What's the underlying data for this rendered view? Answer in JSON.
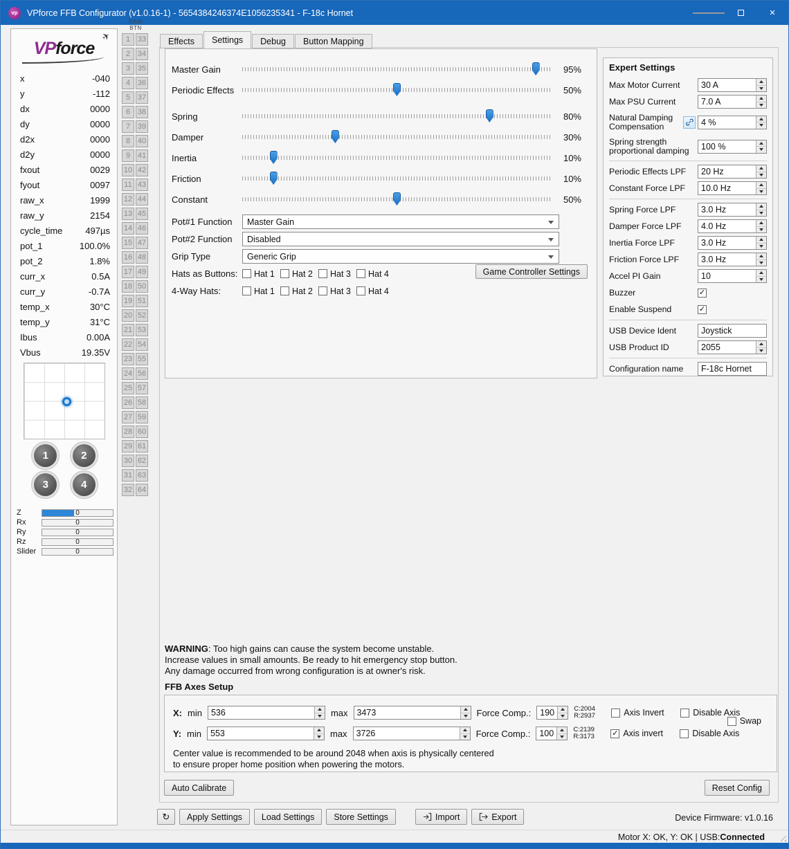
{
  "window": {
    "title": "VPforce FFB Configurator (v1.0.16-1) - 5654384246374E1056235341 - F-18c Hornet",
    "icon_text": "vp",
    "close_glyph": "×"
  },
  "logo": {
    "vp": "VP",
    "force": "force",
    "plane_glyph": "✈"
  },
  "telemetry": [
    {
      "label": "x",
      "value": "-040"
    },
    {
      "label": "y",
      "value": "-112"
    },
    {
      "label": "dx",
      "value": "0000"
    },
    {
      "label": "dy",
      "value": "0000"
    },
    {
      "label": "d2x",
      "value": "0000"
    },
    {
      "label": "d2y",
      "value": "0000"
    },
    {
      "label": "fxout",
      "value": "0029"
    },
    {
      "label": "fyout",
      "value": "0097"
    },
    {
      "label": "raw_x",
      "value": "1999"
    },
    {
      "label": "raw_y",
      "value": "2154"
    },
    {
      "label": "cycle_time",
      "value": "497µs"
    },
    {
      "label": "pot_1",
      "value": "100.0%"
    },
    {
      "label": "pot_2",
      "value": "1.8%"
    },
    {
      "label": "curr_x",
      "value": "0.5A"
    },
    {
      "label": "curr_y",
      "value": "-0.7A"
    },
    {
      "label": "temp_x",
      "value": "30°C"
    },
    {
      "label": "temp_y",
      "value": "31°C"
    },
    {
      "label": "Ibus",
      "value": "0.00A"
    },
    {
      "label": "Vbus",
      "value": "19.35V"
    }
  ],
  "joy_buttons": [
    "1",
    "2",
    "3",
    "4"
  ],
  "axis_bars": [
    {
      "label": "Z",
      "value": "0",
      "fill": 45
    },
    {
      "label": "Rx",
      "value": "0",
      "fill": 0
    },
    {
      "label": "Ry",
      "value": "0",
      "fill": 0
    },
    {
      "label": "Rz",
      "value": "0",
      "fill": 0
    },
    {
      "label": "Slider",
      "value": "0",
      "fill": 0
    }
  ],
  "raw_btn": {
    "header": "RAW BTN",
    "count": 32
  },
  "tabs": [
    {
      "label": "Effects",
      "active": false
    },
    {
      "label": "Settings",
      "active": true
    },
    {
      "label": "Debug",
      "active": false
    },
    {
      "label": "Button Mapping",
      "active": false
    }
  ],
  "sliders": [
    {
      "label": "Master Gain",
      "percent": 95,
      "display": "95%",
      "gap": false
    },
    {
      "label": "Periodic Effects",
      "percent": 50,
      "display": "50%",
      "gap": false
    },
    {
      "label": "Spring",
      "percent": 80,
      "display": "80%",
      "gap": true
    },
    {
      "label": "Damper",
      "percent": 30,
      "display": "30%",
      "gap": false
    },
    {
      "label": "Inertia",
      "percent": 10,
      "display": "10%",
      "gap": false
    },
    {
      "label": "Friction",
      "percent": 10,
      "display": "10%",
      "gap": false
    },
    {
      "label": "Constant",
      "percent": 50,
      "display": "50%",
      "gap": false
    }
  ],
  "dropdowns": [
    {
      "label": "Pot#1 Function",
      "value": "Master Gain"
    },
    {
      "label": "Pot#2 Function",
      "value": "Disabled"
    },
    {
      "label": "Grip Type",
      "value": "Generic Grip"
    }
  ],
  "hats": {
    "row1_label": "Hats as Buttons:",
    "row2_label": "4-Way Hats:",
    "options": [
      "Hat 1",
      "Hat 2",
      "Hat 3",
      "Hat 4"
    ],
    "row1_checked": [
      false,
      false,
      false,
      false
    ],
    "row2_checked": [
      false,
      false,
      false,
      false
    ],
    "game_controller_button": "Game Controller Settings"
  },
  "expert": {
    "title": "Expert Settings",
    "rows": [
      {
        "label": "Max Motor Current",
        "value": "30 A",
        "type": "spin"
      },
      {
        "label": "Max PSU Current",
        "value": "7.0 A",
        "type": "spin"
      },
      {
        "label": "Natural Damping Compensation",
        "value": "4 %",
        "type": "spin",
        "two_line": true,
        "link_icon": true
      },
      {
        "label": "Spring strength proportional damping",
        "value": "100 %",
        "type": "spin",
        "two_line": true,
        "sep_after": true
      },
      {
        "label": "Periodic Effects LPF",
        "value": "20 Hz",
        "type": "spin"
      },
      {
        "label": "Constant Force LPF",
        "value": "10.0 Hz",
        "type": "spin",
        "sep_after": true
      },
      {
        "label": "Spring Force LPF",
        "value": "3.0 Hz",
        "type": "spin"
      },
      {
        "label": "Damper Force LPF",
        "value": "4.0 Hz",
        "type": "spin"
      },
      {
        "label": "Inertia Force LPF",
        "value": "3.0 Hz",
        "type": "spin"
      },
      {
        "label": "Friction Force LPF",
        "value": "3.0 Hz",
        "type": "spin"
      },
      {
        "label": "Accel PI Gain",
        "value": "10",
        "type": "spin"
      },
      {
        "label": "Buzzer",
        "type": "check",
        "checked": true
      },
      {
        "label": "Enable Suspend",
        "type": "check",
        "checked": true,
        "sep_after": true
      },
      {
        "label": "USB Device Ident",
        "value": "Joystick",
        "type": "text"
      },
      {
        "label": "USB Product ID",
        "value": "2055",
        "type": "spin",
        "sep_after": true
      },
      {
        "label": "Configuration name",
        "value": "F-18c Hornet",
        "type": "text"
      }
    ]
  },
  "warning": {
    "line1_bold": "WARNING",
    "line1_rest": ": Too high gains can cause the system become unstable.",
    "line2": "Increase values in small amounts. Be ready to hit emergency stop button.",
    "line3": "Any damage occurred from wrong configuration is at owner's risk."
  },
  "axes_setup": {
    "title": "FFB Axes Setup",
    "rows": [
      {
        "axis": "X:",
        "min_label": "min",
        "min": "536",
        "max_label": "max",
        "max": "3473",
        "fc_label": "Force Comp.:",
        "fc": "190",
        "c": "C:2004",
        "r": "R:2937",
        "invert_label": "Axis Invert",
        "invert": false,
        "disable_label": "Disable Axis",
        "disable": false
      },
      {
        "axis": "Y:",
        "min_label": "min",
        "min": "553",
        "max_label": "max",
        "max": "3726",
        "fc_label": "Force Comp.:",
        "fc": "100",
        "c": "C:2139",
        "r": "R:3173",
        "invert_label": "Axis invert",
        "invert": true,
        "disable_label": "Disable Axis",
        "disable": false
      }
    ],
    "swap_label": "Swap",
    "swap_checked": false,
    "note_line1": "Center value is recommended to be around 2048 when axis is physically centered",
    "note_line2": "to ensure proper home position when powering the motors.",
    "auto_calibrate": "Auto Calibrate",
    "reset_config": "Reset Config"
  },
  "footer": {
    "refresh_glyph": "↻",
    "buttons": [
      "Apply Settings",
      "Load Settings",
      "Store Settings"
    ],
    "import": "Import",
    "export": "Export",
    "firmware": "Device Firmware: v1.0.16"
  },
  "statusbar": {
    "text": "Motor X: OK, Y: OK  |  USB: ",
    "connected": "Connected"
  }
}
